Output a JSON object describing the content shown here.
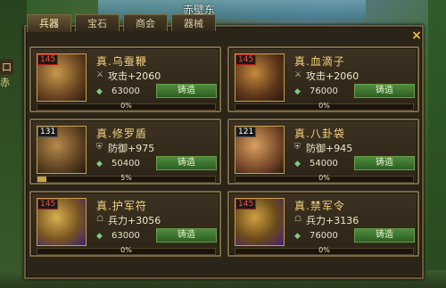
{
  "map_name": "赤壁东",
  "side_labels": [
    "口",
    "赤"
  ],
  "tabs": [
    {
      "label": "兵器",
      "active": true
    },
    {
      "label": "宝石",
      "active": false
    },
    {
      "label": "商会",
      "active": false
    },
    {
      "label": "器械",
      "active": false
    }
  ],
  "close_label": "×",
  "items": [
    {
      "name": "真.乌蚕鞭",
      "level": "145",
      "level_style": "red",
      "stat_icon": "sword-icon",
      "stat": "攻击+2060",
      "price": "63000",
      "button": "铸造",
      "progress_text": "0%",
      "progress": 0
    },
    {
      "name": "真.血滴子",
      "level": "145",
      "level_style": "red",
      "stat_icon": "sword-icon",
      "stat": "攻击+2060",
      "price": "76000",
      "button": "铸造",
      "progress_text": "0%",
      "progress": 0
    },
    {
      "name": "真.修罗盾",
      "level": "131",
      "level_style": "plain",
      "stat_icon": "shield-icon",
      "stat": "防御+975",
      "price": "50400",
      "button": "铸造",
      "progress_text": "5%",
      "progress": 5
    },
    {
      "name": "真.八卦袋",
      "level": "121",
      "level_style": "plain",
      "stat_icon": "shield-icon",
      "stat": "防御+945",
      "price": "54000",
      "button": "铸造",
      "progress_text": "0%",
      "progress": 0
    },
    {
      "name": "真.护军符",
      "level": "145",
      "level_style": "red",
      "stat_icon": "soldier-icon",
      "stat": "兵力+3056",
      "price": "63000",
      "button": "铸造",
      "progress_text": "0%",
      "progress": 0
    },
    {
      "name": "真.禁军令",
      "level": "145",
      "level_style": "red",
      "stat_icon": "soldier-icon",
      "stat": "兵力+3136",
      "price": "76000",
      "button": "铸造",
      "progress_text": "0%",
      "progress": 0
    }
  ]
}
